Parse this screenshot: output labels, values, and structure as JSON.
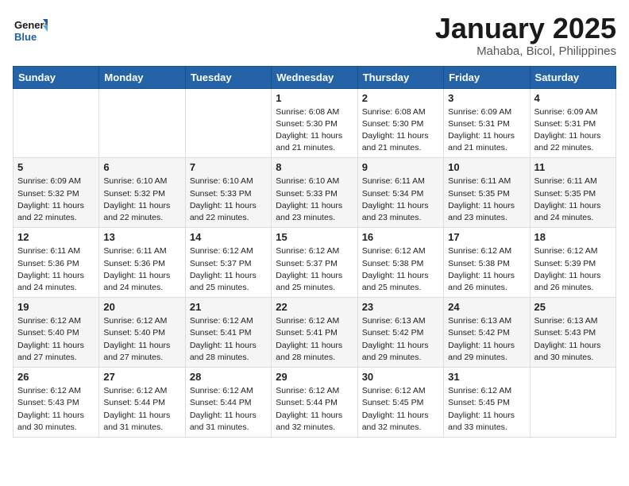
{
  "header": {
    "logo_general": "General",
    "logo_blue": "Blue",
    "month": "January 2025",
    "location": "Mahaba, Bicol, Philippines"
  },
  "weekdays": [
    "Sunday",
    "Monday",
    "Tuesday",
    "Wednesday",
    "Thursday",
    "Friday",
    "Saturday"
  ],
  "weeks": [
    [
      {
        "day": "",
        "sunrise": "",
        "sunset": "",
        "daylight": ""
      },
      {
        "day": "",
        "sunrise": "",
        "sunset": "",
        "daylight": ""
      },
      {
        "day": "",
        "sunrise": "",
        "sunset": "",
        "daylight": ""
      },
      {
        "day": "1",
        "sunrise": "Sunrise: 6:08 AM",
        "sunset": "Sunset: 5:30 PM",
        "daylight": "Daylight: 11 hours and 21 minutes."
      },
      {
        "day": "2",
        "sunrise": "Sunrise: 6:08 AM",
        "sunset": "Sunset: 5:30 PM",
        "daylight": "Daylight: 11 hours and 21 minutes."
      },
      {
        "day": "3",
        "sunrise": "Sunrise: 6:09 AM",
        "sunset": "Sunset: 5:31 PM",
        "daylight": "Daylight: 11 hours and 21 minutes."
      },
      {
        "day": "4",
        "sunrise": "Sunrise: 6:09 AM",
        "sunset": "Sunset: 5:31 PM",
        "daylight": "Daylight: 11 hours and 22 minutes."
      }
    ],
    [
      {
        "day": "5",
        "sunrise": "Sunrise: 6:09 AM",
        "sunset": "Sunset: 5:32 PM",
        "daylight": "Daylight: 11 hours and 22 minutes."
      },
      {
        "day": "6",
        "sunrise": "Sunrise: 6:10 AM",
        "sunset": "Sunset: 5:32 PM",
        "daylight": "Daylight: 11 hours and 22 minutes."
      },
      {
        "day": "7",
        "sunrise": "Sunrise: 6:10 AM",
        "sunset": "Sunset: 5:33 PM",
        "daylight": "Daylight: 11 hours and 22 minutes."
      },
      {
        "day": "8",
        "sunrise": "Sunrise: 6:10 AM",
        "sunset": "Sunset: 5:33 PM",
        "daylight": "Daylight: 11 hours and 23 minutes."
      },
      {
        "day": "9",
        "sunrise": "Sunrise: 6:11 AM",
        "sunset": "Sunset: 5:34 PM",
        "daylight": "Daylight: 11 hours and 23 minutes."
      },
      {
        "day": "10",
        "sunrise": "Sunrise: 6:11 AM",
        "sunset": "Sunset: 5:35 PM",
        "daylight": "Daylight: 11 hours and 23 minutes."
      },
      {
        "day": "11",
        "sunrise": "Sunrise: 6:11 AM",
        "sunset": "Sunset: 5:35 PM",
        "daylight": "Daylight: 11 hours and 24 minutes."
      }
    ],
    [
      {
        "day": "12",
        "sunrise": "Sunrise: 6:11 AM",
        "sunset": "Sunset: 5:36 PM",
        "daylight": "Daylight: 11 hours and 24 minutes."
      },
      {
        "day": "13",
        "sunrise": "Sunrise: 6:11 AM",
        "sunset": "Sunset: 5:36 PM",
        "daylight": "Daylight: 11 hours and 24 minutes."
      },
      {
        "day": "14",
        "sunrise": "Sunrise: 6:12 AM",
        "sunset": "Sunset: 5:37 PM",
        "daylight": "Daylight: 11 hours and 25 minutes."
      },
      {
        "day": "15",
        "sunrise": "Sunrise: 6:12 AM",
        "sunset": "Sunset: 5:37 PM",
        "daylight": "Daylight: 11 hours and 25 minutes."
      },
      {
        "day": "16",
        "sunrise": "Sunrise: 6:12 AM",
        "sunset": "Sunset: 5:38 PM",
        "daylight": "Daylight: 11 hours and 25 minutes."
      },
      {
        "day": "17",
        "sunrise": "Sunrise: 6:12 AM",
        "sunset": "Sunset: 5:38 PM",
        "daylight": "Daylight: 11 hours and 26 minutes."
      },
      {
        "day": "18",
        "sunrise": "Sunrise: 6:12 AM",
        "sunset": "Sunset: 5:39 PM",
        "daylight": "Daylight: 11 hours and 26 minutes."
      }
    ],
    [
      {
        "day": "19",
        "sunrise": "Sunrise: 6:12 AM",
        "sunset": "Sunset: 5:40 PM",
        "daylight": "Daylight: 11 hours and 27 minutes."
      },
      {
        "day": "20",
        "sunrise": "Sunrise: 6:12 AM",
        "sunset": "Sunset: 5:40 PM",
        "daylight": "Daylight: 11 hours and 27 minutes."
      },
      {
        "day": "21",
        "sunrise": "Sunrise: 6:12 AM",
        "sunset": "Sunset: 5:41 PM",
        "daylight": "Daylight: 11 hours and 28 minutes."
      },
      {
        "day": "22",
        "sunrise": "Sunrise: 6:12 AM",
        "sunset": "Sunset: 5:41 PM",
        "daylight": "Daylight: 11 hours and 28 minutes."
      },
      {
        "day": "23",
        "sunrise": "Sunrise: 6:13 AM",
        "sunset": "Sunset: 5:42 PM",
        "daylight": "Daylight: 11 hours and 29 minutes."
      },
      {
        "day": "24",
        "sunrise": "Sunrise: 6:13 AM",
        "sunset": "Sunset: 5:42 PM",
        "daylight": "Daylight: 11 hours and 29 minutes."
      },
      {
        "day": "25",
        "sunrise": "Sunrise: 6:13 AM",
        "sunset": "Sunset: 5:43 PM",
        "daylight": "Daylight: 11 hours and 30 minutes."
      }
    ],
    [
      {
        "day": "26",
        "sunrise": "Sunrise: 6:12 AM",
        "sunset": "Sunset: 5:43 PM",
        "daylight": "Daylight: 11 hours and 30 minutes."
      },
      {
        "day": "27",
        "sunrise": "Sunrise: 6:12 AM",
        "sunset": "Sunset: 5:44 PM",
        "daylight": "Daylight: 11 hours and 31 minutes."
      },
      {
        "day": "28",
        "sunrise": "Sunrise: 6:12 AM",
        "sunset": "Sunset: 5:44 PM",
        "daylight": "Daylight: 11 hours and 31 minutes."
      },
      {
        "day": "29",
        "sunrise": "Sunrise: 6:12 AM",
        "sunset": "Sunset: 5:44 PM",
        "daylight": "Daylight: 11 hours and 32 minutes."
      },
      {
        "day": "30",
        "sunrise": "Sunrise: 6:12 AM",
        "sunset": "Sunset: 5:45 PM",
        "daylight": "Daylight: 11 hours and 32 minutes."
      },
      {
        "day": "31",
        "sunrise": "Sunrise: 6:12 AM",
        "sunset": "Sunset: 5:45 PM",
        "daylight": "Daylight: 11 hours and 33 minutes."
      },
      {
        "day": "",
        "sunrise": "",
        "sunset": "",
        "daylight": ""
      }
    ]
  ]
}
